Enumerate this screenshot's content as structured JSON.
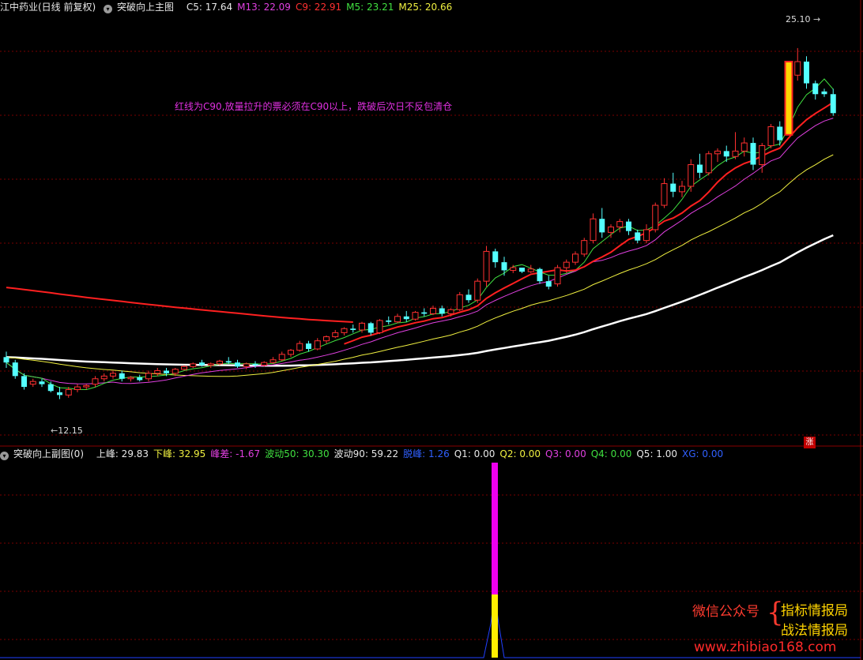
{
  "main_header": {
    "stock": "江中药业(日线 前复权)",
    "indicator": "突破向上主图",
    "items": [
      {
        "label": "C5: 17.64",
        "color": "#e8e8e8"
      },
      {
        "label": "M13: 22.09",
        "color": "#e040e0"
      },
      {
        "label": "C9: 22.91",
        "color": "#ff3030"
      },
      {
        "label": "M5: 23.21",
        "color": "#40e040"
      },
      {
        "label": "M25: 20.66",
        "color": "#f0f040"
      }
    ]
  },
  "sub_header": {
    "indicator": "突破向上副图(0)",
    "items": [
      {
        "label": "上峰: 29.83",
        "color": "#e8e8e8"
      },
      {
        "label": "下峰: 32.95",
        "color": "#f0f040"
      },
      {
        "label": "峰差: -1.67",
        "color": "#e040e0"
      },
      {
        "label": "波动50: 30.30",
        "color": "#40e040"
      },
      {
        "label": "波动90: 59.22",
        "color": "#e8e8e8"
      },
      {
        "label": "脱峰: 1.26",
        "color": "#3060ff"
      },
      {
        "label": "Q1: 0.00",
        "color": "#e8e8e8"
      },
      {
        "label": "Q2: 0.00",
        "color": "#f0f040"
      },
      {
        "label": "Q3: 0.00",
        "color": "#e040e0"
      },
      {
        "label": "Q4: 0.00",
        "color": "#40e040"
      },
      {
        "label": "Q5: 1.00",
        "color": "#e8e8e8"
      },
      {
        "label": "XG: 0.00",
        "color": "#3060ff"
      }
    ]
  },
  "annotation": "红线为C90,放量拉升的票必须在C90以上，跌破后次日不反包清仓",
  "peak_label": "25.10",
  "low_label": "12.15",
  "badge": "涨",
  "watermark": {
    "title": "微信公众号",
    "brace": "{",
    "line1": "指标情报局",
    "line2": "战法情报局",
    "url": "www.zhibiao168.com"
  },
  "colors": {
    "up": "#ff3030",
    "down": "#54ffff",
    "grid": "#7a0000"
  },
  "chart_data": {
    "type": "candlestick",
    "ylim": [
      11,
      26
    ],
    "candles": [
      [
        13.7,
        13.9,
        13.3,
        13.5
      ],
      [
        13.5,
        13.6,
        12.9,
        13.0
      ],
      [
        13.0,
        13.1,
        12.5,
        12.6
      ],
      [
        12.7,
        12.9,
        12.6,
        12.8
      ],
      [
        12.8,
        12.9,
        12.6,
        12.7
      ],
      [
        12.7,
        12.8,
        12.4,
        12.45
      ],
      [
        12.4,
        12.6,
        12.15,
        12.3
      ],
      [
        12.3,
        12.6,
        12.2,
        12.5
      ],
      [
        12.5,
        12.7,
        12.4,
        12.6
      ],
      [
        12.6,
        12.7,
        12.5,
        12.65
      ],
      [
        12.7,
        13.0,
        12.6,
        12.9
      ],
      [
        12.9,
        13.1,
        12.8,
        13.0
      ],
      [
        13.0,
        13.2,
        12.9,
        13.1
      ],
      [
        13.1,
        13.2,
        12.8,
        12.9
      ],
      [
        12.9,
        13.0,
        12.8,
        12.95
      ],
      [
        12.95,
        13.05,
        12.8,
        12.85
      ],
      [
        12.9,
        13.2,
        12.8,
        13.1
      ],
      [
        13.1,
        13.3,
        13.0,
        13.2
      ],
      [
        13.2,
        13.3,
        13.0,
        13.1
      ],
      [
        13.1,
        13.3,
        13.0,
        13.25
      ],
      [
        13.25,
        13.4,
        13.2,
        13.35
      ],
      [
        13.35,
        13.5,
        13.3,
        13.45
      ],
      [
        13.5,
        13.6,
        13.35,
        13.4
      ],
      [
        13.4,
        13.5,
        13.3,
        13.45
      ],
      [
        13.45,
        13.6,
        13.4,
        13.55
      ],
      [
        13.55,
        13.7,
        13.45,
        13.5
      ],
      [
        13.5,
        13.6,
        13.3,
        13.35
      ],
      [
        13.35,
        13.5,
        13.25,
        13.45
      ],
      [
        13.45,
        13.55,
        13.3,
        13.4
      ],
      [
        13.4,
        13.55,
        13.35,
        13.5
      ],
      [
        13.5,
        13.7,
        13.45,
        13.6
      ],
      [
        13.6,
        13.9,
        13.55,
        13.8
      ],
      [
        13.8,
        14.0,
        13.7,
        13.95
      ],
      [
        13.95,
        14.3,
        13.9,
        14.2
      ],
      [
        14.2,
        14.3,
        13.9,
        14.0
      ],
      [
        14.0,
        14.4,
        13.95,
        14.3
      ],
      [
        14.3,
        14.5,
        14.2,
        14.45
      ],
      [
        14.45,
        14.7,
        14.4,
        14.6
      ],
      [
        14.6,
        14.8,
        14.5,
        14.75
      ],
      [
        14.75,
        14.9,
        14.6,
        14.7
      ],
      [
        14.7,
        15.0,
        14.6,
        14.95
      ],
      [
        14.95,
        15.0,
        14.5,
        14.6
      ],
      [
        14.6,
        15.1,
        14.55,
        15.05
      ],
      [
        15.05,
        15.2,
        14.9,
        15.0
      ],
      [
        15.0,
        15.3,
        14.95,
        15.2
      ],
      [
        15.2,
        15.4,
        15.0,
        15.1
      ],
      [
        15.1,
        15.4,
        15.05,
        15.35
      ],
      [
        15.35,
        15.5,
        15.2,
        15.3
      ],
      [
        15.3,
        15.6,
        15.25,
        15.5
      ],
      [
        15.5,
        15.6,
        15.2,
        15.3
      ],
      [
        15.3,
        15.5,
        15.2,
        15.45
      ],
      [
        15.45,
        16.1,
        15.4,
        16.0
      ],
      [
        16.0,
        16.2,
        15.7,
        15.8
      ],
      [
        15.8,
        16.6,
        15.7,
        16.5
      ],
      [
        16.5,
        17.8,
        16.3,
        17.6
      ],
      [
        17.6,
        17.7,
        17.0,
        17.2
      ],
      [
        17.2,
        17.4,
        16.7,
        16.9
      ],
      [
        16.9,
        17.1,
        16.8,
        17.0
      ],
      [
        17.0,
        17.0,
        16.8,
        16.85
      ],
      [
        16.85,
        17.1,
        16.8,
        16.95
      ],
      [
        16.95,
        17.0,
        16.4,
        16.5
      ],
      [
        16.5,
        16.7,
        16.2,
        16.3
      ],
      [
        16.4,
        17.1,
        16.3,
        17.0
      ],
      [
        17.0,
        17.3,
        16.8,
        17.2
      ],
      [
        17.2,
        17.6,
        17.1,
        17.5
      ],
      [
        17.5,
        18.1,
        17.4,
        18.0
      ],
      [
        18.0,
        19.0,
        17.9,
        18.8
      ],
      [
        18.8,
        19.2,
        18.1,
        18.3
      ],
      [
        18.3,
        18.6,
        18.1,
        18.5
      ],
      [
        18.5,
        18.8,
        18.3,
        18.7
      ],
      [
        18.7,
        18.8,
        18.2,
        18.35
      ],
      [
        18.3,
        18.4,
        17.9,
        18.0
      ],
      [
        18.0,
        18.6,
        17.9,
        18.4
      ],
      [
        18.4,
        19.4,
        18.3,
        19.3
      ],
      [
        19.3,
        20.3,
        19.2,
        20.1
      ],
      [
        20.1,
        20.5,
        19.6,
        19.8
      ],
      [
        19.8,
        20.2,
        19.6,
        20.0
      ],
      [
        20.0,
        21.0,
        19.8,
        20.8
      ],
      [
        20.8,
        21.2,
        20.3,
        20.5
      ],
      [
        20.5,
        21.3,
        20.4,
        21.2
      ],
      [
        21.2,
        21.4,
        20.9,
        21.3
      ],
      [
        21.3,
        21.5,
        20.9,
        21.1
      ],
      [
        21.1,
        22.0,
        21.0,
        21.3
      ],
      [
        21.3,
        21.8,
        21.1,
        21.6
      ],
      [
        21.6,
        21.8,
        20.6,
        20.8
      ],
      [
        20.8,
        21.6,
        20.5,
        21.5
      ],
      [
        21.5,
        22.3,
        21.4,
        22.2
      ],
      [
        22.2,
        22.4,
        21.5,
        21.7
      ],
      [
        21.9,
        24.6,
        21.9,
        24.6
      ],
      [
        24.1,
        25.1,
        23.9,
        24.6
      ],
      [
        24.6,
        24.8,
        23.6,
        23.8
      ],
      [
        23.8,
        23.9,
        23.2,
        23.4
      ],
      [
        23.5,
        23.6,
        23.3,
        23.4
      ],
      [
        23.4,
        23.6,
        22.6,
        22.7
      ]
    ]
  }
}
